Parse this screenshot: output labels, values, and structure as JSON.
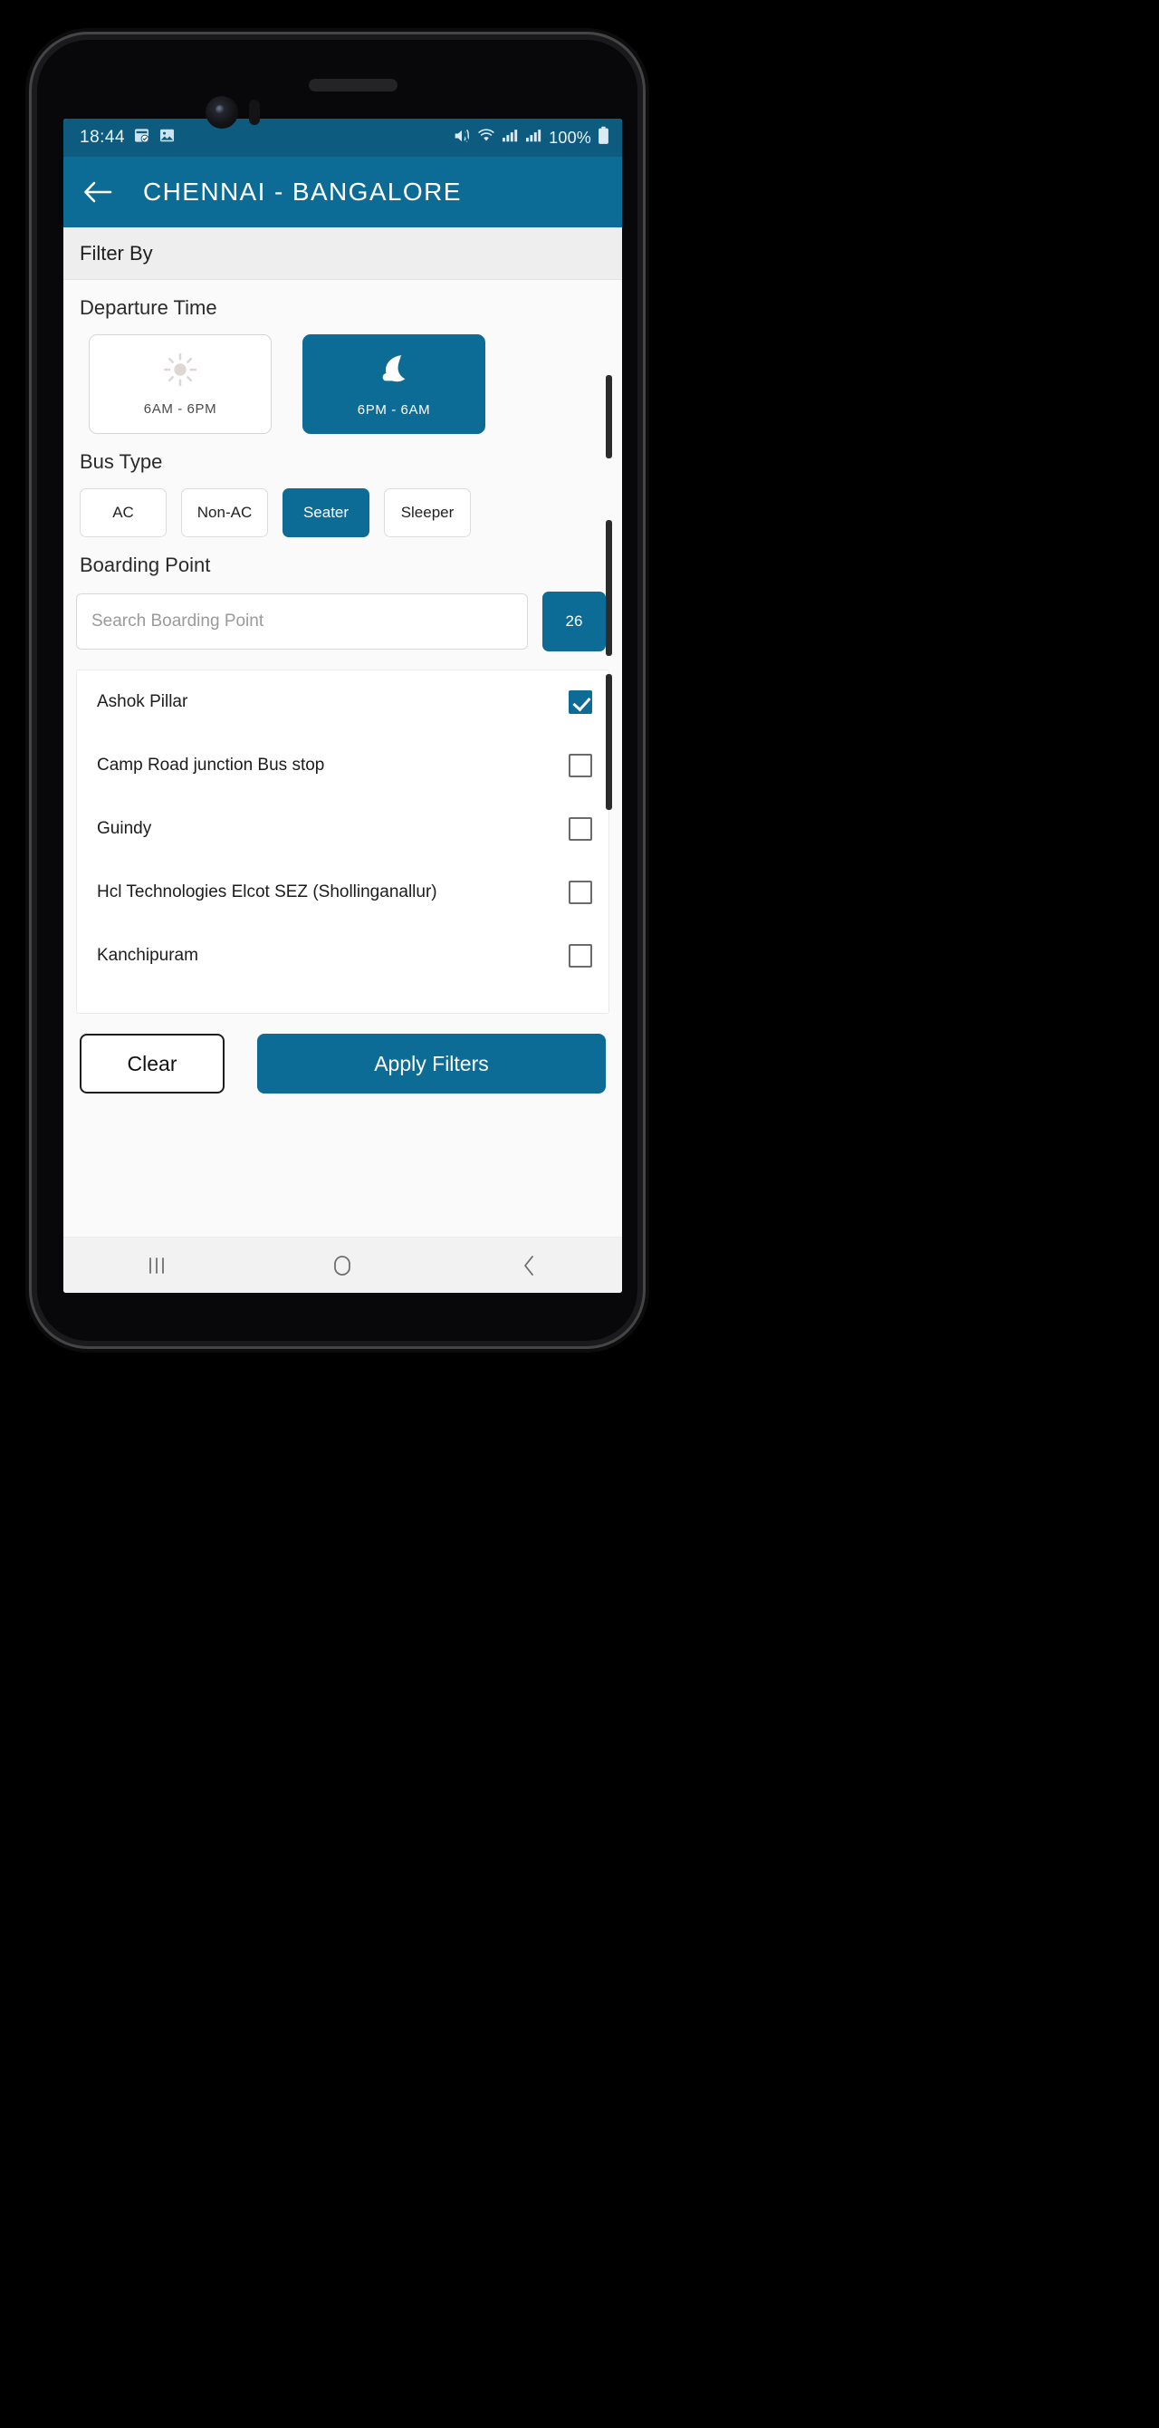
{
  "status_bar": {
    "time": "18:44",
    "left_icons": [
      "calendar-check-icon",
      "image-icon"
    ],
    "right_icons": [
      "mute-icon",
      "wifi-icon",
      "signal-sim1-icon",
      "signal-sim2-icon"
    ],
    "battery_percent": "100%",
    "battery_icon": "battery-full-icon",
    "background_color": "#0d5b7f"
  },
  "app_bar": {
    "back_icon": "back-arrow-icon",
    "title": "CHENNAI - BANGALORE",
    "background_color": "#0d6c95"
  },
  "filter_header": {
    "title": "Filter By"
  },
  "departure_time": {
    "section_title": "Departure Time",
    "options": [
      {
        "label": "6AM - 6PM",
        "icon": "sun-icon",
        "selected": false
      },
      {
        "label": "6PM - 6AM",
        "icon": "moon-cloud-icon",
        "selected": true
      }
    ]
  },
  "bus_type": {
    "section_title": "Bus Type",
    "options": [
      {
        "label": "AC",
        "selected": false
      },
      {
        "label": "Non-AC",
        "selected": false
      },
      {
        "label": "Seater",
        "selected": true
      },
      {
        "label": "Sleeper",
        "selected": false
      }
    ]
  },
  "boarding_point": {
    "section_title": "Boarding Point",
    "search_placeholder": "Search Boarding Point",
    "search_value": "",
    "count_badge": "26",
    "items": [
      {
        "label": "Ashok Pillar",
        "checked": true
      },
      {
        "label": "Camp Road junction Bus stop",
        "checked": false
      },
      {
        "label": "Guindy",
        "checked": false
      },
      {
        "label": "Hcl Technologies Elcot SEZ (Shollinganallur)",
        "checked": false
      },
      {
        "label": "Kanchipuram",
        "checked": false
      }
    ]
  },
  "footer": {
    "clear_label": "Clear",
    "apply_label": "Apply Filters"
  },
  "nav_bar": {
    "recents_icon": "recents-icon",
    "home_icon": "home-icon",
    "back_icon": "back-chevron-icon"
  },
  "theme": {
    "accent": "#0d6c95",
    "status_bar": "#0d5b7f",
    "page_bg": "#fafafa"
  }
}
